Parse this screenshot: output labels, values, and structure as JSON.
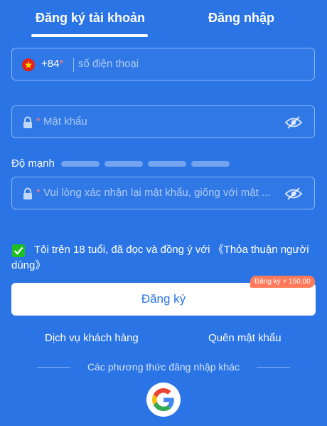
{
  "tabs": {
    "register": "Đăng ký tài khoản",
    "login": "Đăng nhập"
  },
  "phone": {
    "country_code": "+84",
    "required_mark": "*",
    "placeholder": "số điện thoại"
  },
  "password": {
    "required_mark": "*",
    "placeholder": "Mật khẩu"
  },
  "strength": {
    "label": "Độ mạnh"
  },
  "confirm": {
    "required_mark": "*",
    "placeholder": "Vui lòng xác nhận lại mật khẩu, giống với mật ..."
  },
  "agreement": {
    "text": "Tôi trên 18 tuổi, đã đọc và đồng ý với ",
    "link": "《Thỏa thuận người dùng》",
    "checked": true
  },
  "register_button": {
    "label": "Đăng ký",
    "promo": "Đăng ký + 150,00"
  },
  "links": {
    "service": "Dịch vụ khách hàng",
    "forgot": "Quên mật khẩu"
  },
  "other_methods": {
    "label": "Các phương thức đăng nhập khác"
  },
  "colors": {
    "background": "#2a74e6",
    "check": "#1ec01e",
    "promo": "#ff7a5a",
    "required": "#ff7a7a"
  },
  "icons": [
    "vietnam-flag-icon",
    "lock-icon",
    "eye-off-icon",
    "checkbox-icon",
    "google-icon"
  ]
}
